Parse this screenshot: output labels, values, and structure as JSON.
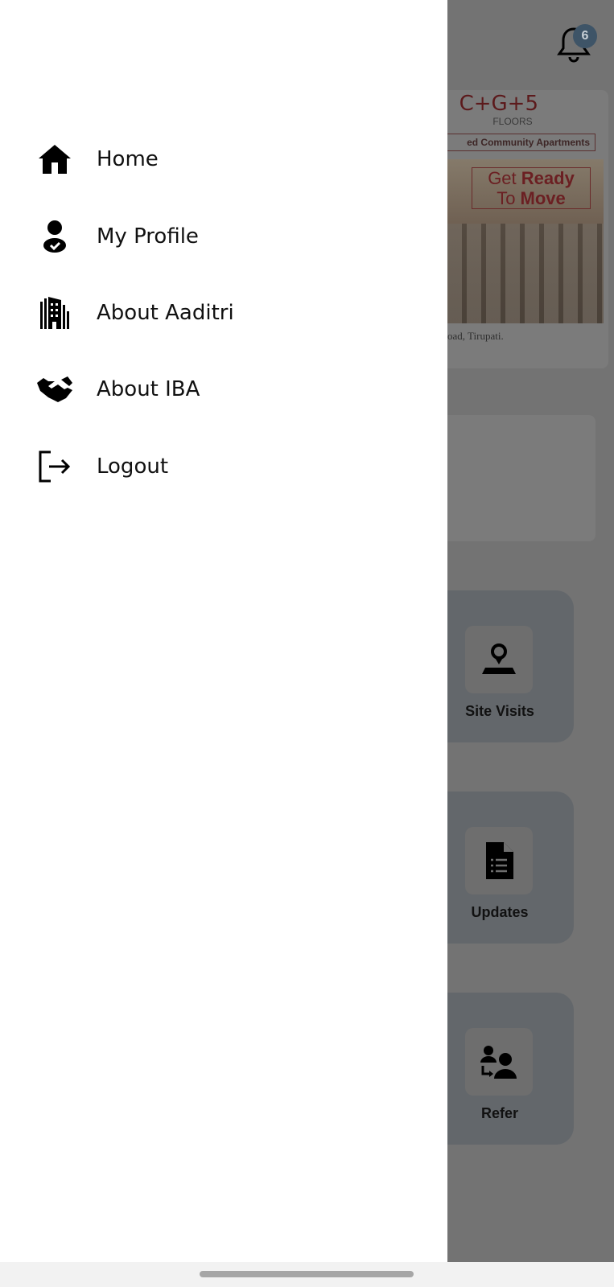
{
  "background": {
    "notification_count": "6",
    "banner": {
      "title": "C+G+5",
      "floors": "FLOORS",
      "community": "ed Community Apartments",
      "ready_1": "Get ",
      "ready_2": "Ready",
      "move_1": "To ",
      "move_2": "Move",
      "address": "oad, Tirupati."
    },
    "tiles": [
      {
        "label": "Site Visits",
        "icon": "map-pin-icon"
      },
      {
        "label": "Updates",
        "icon": "document-icon"
      },
      {
        "label": "Refer",
        "icon": "refer-users-icon"
      }
    ]
  },
  "drawer": {
    "items": [
      {
        "label": "Home",
        "icon": "home-icon"
      },
      {
        "label": "My Profile",
        "icon": "profile-check-icon"
      },
      {
        "label": "About Aaditri",
        "icon": "building-icon"
      },
      {
        "label": "About IBA",
        "icon": "handshake-icon"
      },
      {
        "label": "Logout",
        "icon": "logout-icon"
      }
    ]
  },
  "colors": {
    "overlay": "#737373",
    "drawer": "#ffffff",
    "badge": "#3e5467",
    "banner_accent": "#6b1f22"
  }
}
